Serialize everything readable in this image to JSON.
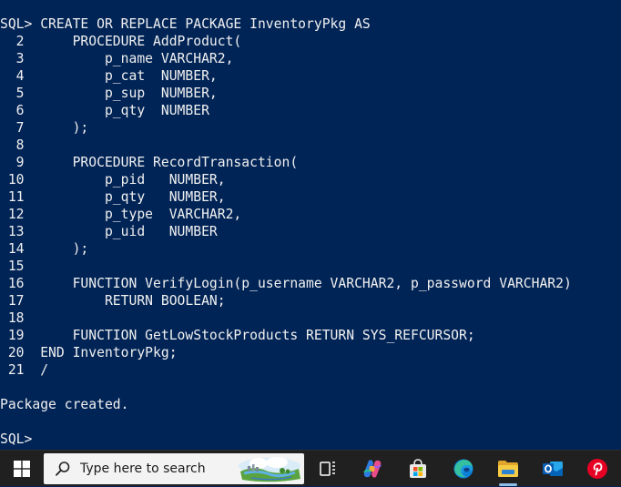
{
  "terminal": {
    "lines": [
      "SQL> CREATE OR REPLACE PACKAGE InventoryPkg AS",
      "  2      PROCEDURE AddProduct(",
      "  3          p_name VARCHAR2,",
      "  4          p_cat  NUMBER,",
      "  5          p_sup  NUMBER,",
      "  6          p_qty  NUMBER",
      "  7      );",
      "  8",
      "  9      PROCEDURE RecordTransaction(",
      " 10          p_pid   NUMBER,",
      " 11          p_qty   NUMBER,",
      " 12          p_type  VARCHAR2,",
      " 13          p_uid   NUMBER",
      " 14      );",
      " 15",
      " 16      FUNCTION VerifyLogin(p_username VARCHAR2, p_password VARCHAR2)",
      " 17          RETURN BOOLEAN;",
      " 18",
      " 19      FUNCTION GetLowStockProducts RETURN SYS_REFCURSOR;",
      " 20  END InventoryPkg;",
      " 21  /",
      "",
      "Package created.",
      "",
      "SQL>"
    ],
    "background": "#012456",
    "text_color": "#f0f0f0"
  },
  "taskbar": {
    "search_placeholder": "Type here to search",
    "icons": [
      "windows-start-icon",
      "search-icon",
      "task-view-icon",
      "copilot-icon",
      "microsoft-store-icon",
      "edge-icon",
      "file-explorer-icon",
      "outlook-icon",
      "pinterest-icon"
    ],
    "active_app": "file-explorer-icon"
  }
}
